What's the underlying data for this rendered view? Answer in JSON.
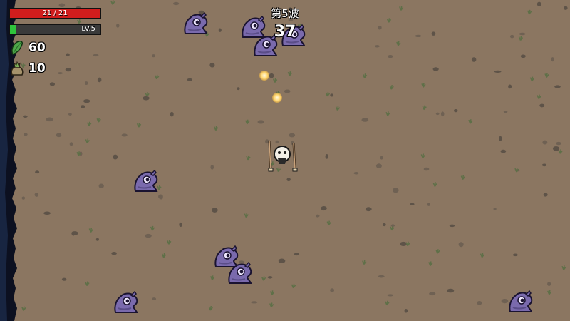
{
  "hud": {
    "hp": {
      "current": 21,
      "max": 21,
      "text": "21 / 21",
      "color": "#d11d1d"
    },
    "xp": {
      "level_text": "LV.5",
      "progress": 0.06,
      "color": "#2fc43c"
    },
    "materials": {
      "icon": "green-leaf-material-icon",
      "value": "60"
    },
    "bag": {
      "icon": "material-bag-icon",
      "value": "10"
    }
  },
  "wave": {
    "label": "第5波",
    "timer": "37"
  },
  "entities": {
    "enemy_type": "purple-baby-alien",
    "enemy_count": 10,
    "projectile_count": 2,
    "player": "potato-character-with-two-sticks"
  }
}
